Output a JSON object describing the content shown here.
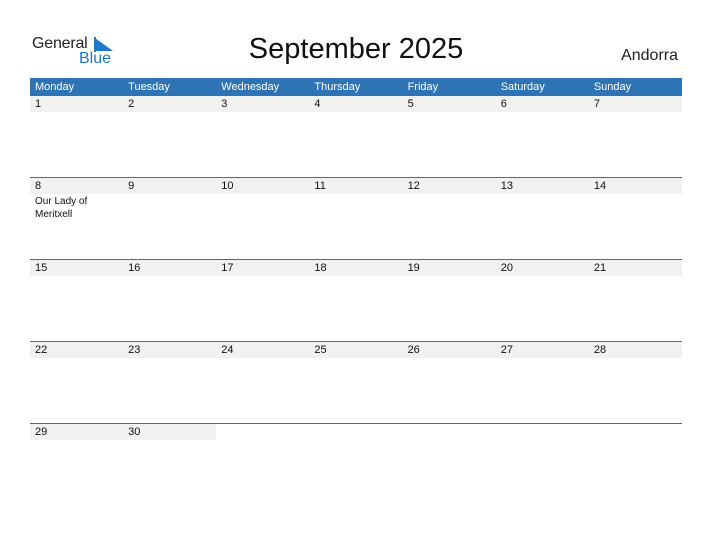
{
  "logo": {
    "general": "General",
    "blue": "Blue"
  },
  "title": "September 2025",
  "country": "Andorra",
  "weekdays": [
    "Monday",
    "Tuesday",
    "Wednesday",
    "Thursday",
    "Friday",
    "Saturday",
    "Sunday"
  ],
  "weeks": [
    {
      "days": [
        "1",
        "2",
        "3",
        "4",
        "5",
        "6",
        "7"
      ],
      "holidays": [
        "",
        "",
        "",
        "",
        "",
        "",
        ""
      ]
    },
    {
      "days": [
        "8",
        "9",
        "10",
        "11",
        "12",
        "13",
        "14"
      ],
      "holidays": [
        "Our Lady of Meritxell",
        "",
        "",
        "",
        "",
        "",
        ""
      ]
    },
    {
      "days": [
        "15",
        "16",
        "17",
        "18",
        "19",
        "20",
        "21"
      ],
      "holidays": [
        "",
        "",
        "",
        "",
        "",
        "",
        ""
      ]
    },
    {
      "days": [
        "22",
        "23",
        "24",
        "25",
        "26",
        "27",
        "28"
      ],
      "holidays": [
        "",
        "",
        "",
        "",
        "",
        "",
        ""
      ]
    },
    {
      "days": [
        "29",
        "30",
        "",
        "",
        "",
        "",
        ""
      ],
      "holidays": [
        "",
        "",
        "",
        "",
        "",
        "",
        ""
      ]
    }
  ],
  "colors": {
    "accent": "#2e74b5",
    "logo_blue": "#1f78c8",
    "day_row_bg": "#f1f1f1"
  }
}
